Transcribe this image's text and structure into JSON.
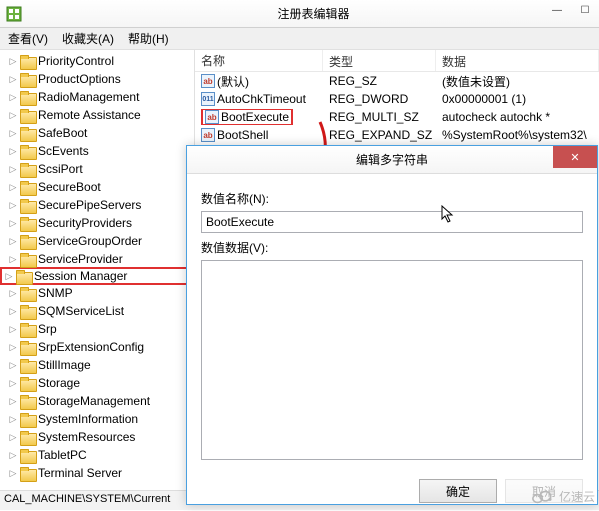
{
  "window": {
    "title": "注册表编辑器",
    "min": "—",
    "max": "☐",
    "close": "✕"
  },
  "menu": {
    "view": "查看(V)",
    "fav": "收藏夹(A)",
    "help": "帮助(H)"
  },
  "tree": {
    "items": [
      {
        "label": "PriorityControl"
      },
      {
        "label": "ProductOptions"
      },
      {
        "label": "RadioManagement"
      },
      {
        "label": "Remote Assistance"
      },
      {
        "label": "SafeBoot"
      },
      {
        "label": "ScEvents"
      },
      {
        "label": "ScsiPort"
      },
      {
        "label": "SecureBoot"
      },
      {
        "label": "SecurePipeServers"
      },
      {
        "label": "SecurityProviders"
      },
      {
        "label": "ServiceGroupOrder"
      },
      {
        "label": "ServiceProvider"
      },
      {
        "label": "Session Manager",
        "hl": true
      },
      {
        "label": "SNMP"
      },
      {
        "label": "SQMServiceList"
      },
      {
        "label": "Srp"
      },
      {
        "label": "SrpExtensionConfig"
      },
      {
        "label": "StillImage"
      },
      {
        "label": "Storage"
      },
      {
        "label": "StorageManagement"
      },
      {
        "label": "SystemInformation"
      },
      {
        "label": "SystemResources"
      },
      {
        "label": "TabletPC"
      },
      {
        "label": "Terminal Server"
      }
    ]
  },
  "list": {
    "headers": {
      "name": "名称",
      "type": "类型",
      "data": "数据"
    },
    "rows": [
      {
        "icon": "ab",
        "name": "(默认)",
        "type": "REG_SZ",
        "data": "(数值未设置)"
      },
      {
        "icon": "bin",
        "name": "AutoChkTimeout",
        "type": "REG_DWORD",
        "data": "0x00000001 (1)"
      },
      {
        "icon": "ab",
        "name": "BootExecute",
        "type": "REG_MULTI_SZ",
        "data": "autocheck autochk *",
        "hl": true
      },
      {
        "icon": "ab",
        "name": "BootShell",
        "type": "REG_EXPAND_SZ",
        "data": "%SystemRoot%\\system32\\"
      }
    ]
  },
  "dialog": {
    "title": "编辑多字符串",
    "name_label": "数值名称(N):",
    "name_value": "BootExecute",
    "data_label": "数值数据(V):",
    "data_value": "",
    "ok": "确定",
    "cancel": "取消"
  },
  "statusbar": "CAL_MACHINE\\SYSTEM\\Current",
  "watermark": "亿速云"
}
